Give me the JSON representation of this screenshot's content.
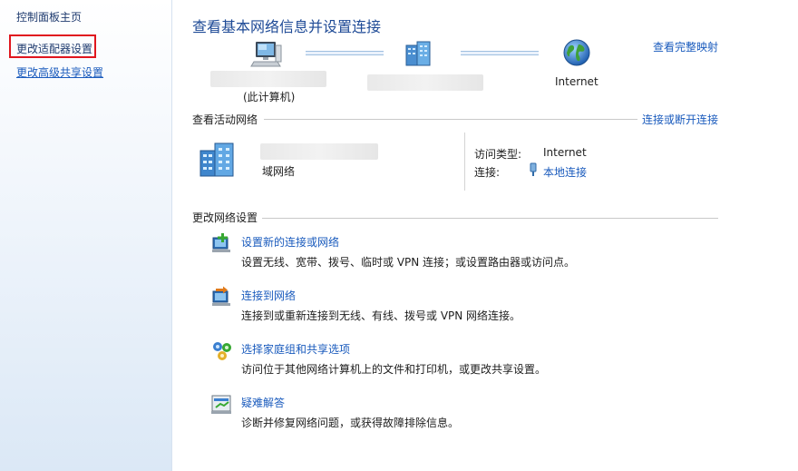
{
  "sidebar": {
    "items": [
      {
        "label": "控制面板主页"
      },
      {
        "label": "更改适配器设置"
      },
      {
        "label": "更改高级共享设置"
      }
    ]
  },
  "main": {
    "title": "查看基本网络信息并设置连接",
    "view_full_map": "查看完整映射",
    "network_map": {
      "computer_caption": "(此计算机)",
      "internet_label": "Internet"
    },
    "active_networks": {
      "header": "查看活动网络",
      "connect_disconnect": "连接或断开连接",
      "network_type": "域网络",
      "access_type_label": "访问类型:",
      "access_type_value": "Internet",
      "connection_label": "连接:",
      "connection_value": "本地连接"
    },
    "change_settings": {
      "header": "更改网络设置",
      "tasks": [
        {
          "title": "设置新的连接或网络",
          "desc": "设置无线、宽带、拨号、临时或 VPN 连接；或设置路由器或访问点。",
          "icon": "new-connection-icon"
        },
        {
          "title": "连接到网络",
          "desc": "连接到或重新连接到无线、有线、拨号或 VPN 网络连接。",
          "icon": "connect-network-icon"
        },
        {
          "title": "选择家庭组和共享选项",
          "desc": "访问位于其他网络计算机上的文件和打印机，或更改共享设置。",
          "icon": "homegroup-icon"
        },
        {
          "title": "疑难解答",
          "desc": "诊断并修复网络问题，或获得故障排除信息。",
          "icon": "troubleshoot-icon"
        }
      ]
    }
  },
  "colors": {
    "link": "#1a5bbd",
    "title": "#1e4a96",
    "highlight_box": "#e0161e"
  }
}
